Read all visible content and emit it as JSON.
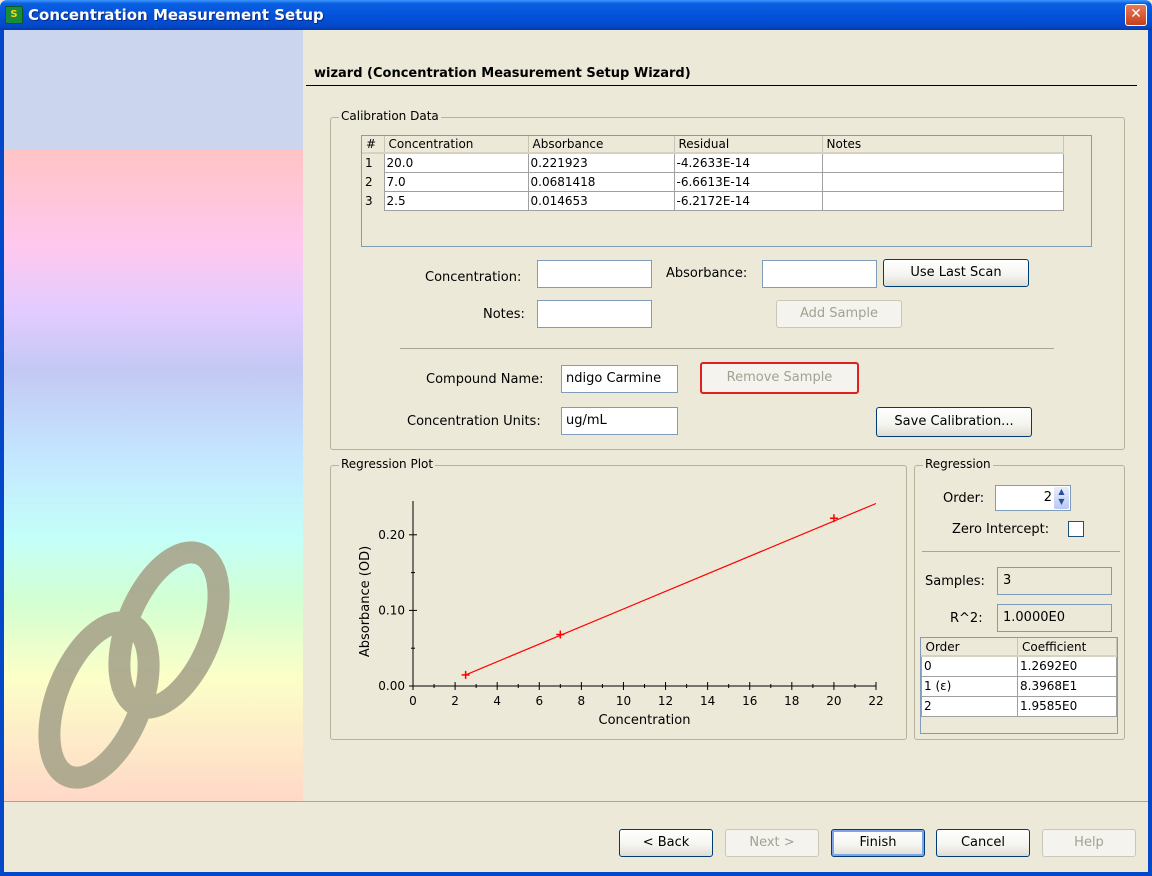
{
  "window": {
    "title": "Concentration Measurement Setup",
    "icon_text": "S"
  },
  "wizard_title": "wizard (Concentration Measurement Setup Wizard)",
  "calibration": {
    "legend": "Calibration Data",
    "columns": [
      "#",
      "Concentration",
      "Absorbance",
      "Residual",
      "Notes"
    ],
    "rows": [
      [
        "1",
        "20.0",
        "0.221923",
        "-4.2633E-14",
        ""
      ],
      [
        "2",
        "7.0",
        "0.0681418",
        "-6.6613E-14",
        ""
      ],
      [
        "3",
        "2.5",
        "0.014653",
        "-6.2172E-14",
        ""
      ]
    ],
    "concentration_label": "Concentration:",
    "concentration_value": "",
    "absorbance_label": "Absorbance:",
    "absorbance_value": "",
    "use_last_scan": "Use Last Scan",
    "notes_label": "Notes:",
    "notes_value": "",
    "add_sample": "Add Sample",
    "compound_label": "Compound Name:",
    "compound_value": "ndigo Carmine",
    "remove_sample": "Remove Sample",
    "units_label": "Concentration Units:",
    "units_value": "ug/mL",
    "save_calibration": "Save Calibration..."
  },
  "plot": {
    "legend": "Regression Plot",
    "color": "#ff0000"
  },
  "chart_data": {
    "type": "scatter",
    "xlabel": "Concentration",
    "ylabel": "Absorbance (OD)",
    "xlim": [
      0,
      22
    ],
    "ylim": [
      0,
      0.25
    ],
    "xticks": [
      "0",
      "2",
      "4",
      "6",
      "8",
      "10",
      "12",
      "14",
      "16",
      "18",
      "20",
      "22"
    ],
    "yticks": [
      "0.00",
      "0.10",
      "0.20"
    ],
    "points": [
      {
        "x": 2.5,
        "y": 0.014653
      },
      {
        "x": 7.0,
        "y": 0.0681418
      },
      {
        "x": 20.0,
        "y": 0.221923
      }
    ],
    "fit_line": {
      "x": [
        2.5,
        22
      ],
      "y": [
        0.0147,
        0.2414
      ]
    }
  },
  "regression": {
    "legend": "Regression",
    "order_label": "Order:",
    "order_value": "2",
    "zero_intercept_label": "Zero Intercept:",
    "zero_intercept_checked": false,
    "samples_label": "Samples:",
    "samples_value": "3",
    "r2_label": "R^2:",
    "r2_value": "1.0000E0",
    "coef_columns": [
      "Order",
      "Coefficient"
    ],
    "coef_rows": [
      [
        "0",
        "1.2692E0"
      ],
      [
        "1 (ε)",
        "8.3968E1"
      ],
      [
        "2",
        "1.9585E0"
      ]
    ]
  },
  "footer": {
    "back": "< Back",
    "next": "Next >",
    "finish": "Finish",
    "cancel": "Cancel",
    "help": "Help"
  }
}
